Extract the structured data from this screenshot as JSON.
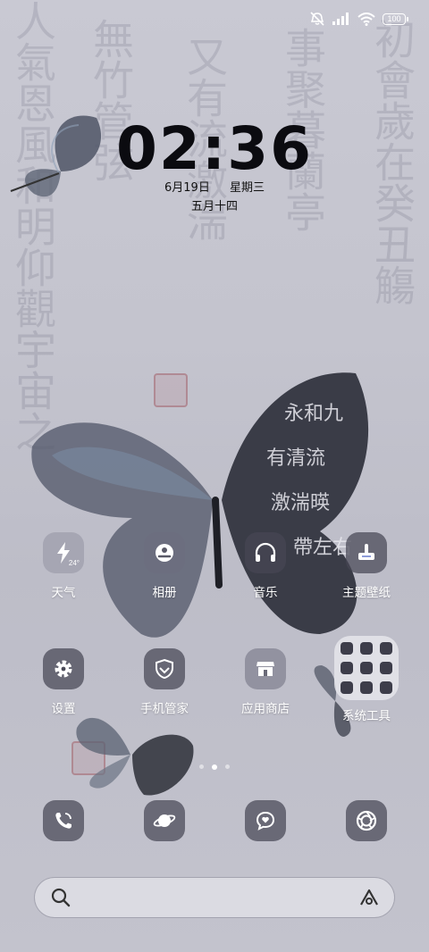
{
  "status_bar": {
    "battery": "100",
    "icons": [
      "notifications-muted-icon",
      "signal-icon",
      "wifi-icon",
      "battery-icon"
    ]
  },
  "clock": {
    "time": "02:36",
    "date": "6月19日",
    "weekday": "星期三",
    "lunar": "五月十四"
  },
  "apps": [
    {
      "label": "天气",
      "icon": "weather-bolt-icon",
      "badge": "24°"
    },
    {
      "label": "相册",
      "icon": "gallery-icon"
    },
    {
      "label": "音乐",
      "icon": "headphones-icon"
    },
    {
      "label": "主题壁纸",
      "icon": "theme-brush-icon"
    },
    {
      "label": "设置",
      "icon": "gear-icon"
    },
    {
      "label": "手机管家",
      "icon": "security-shield-icon"
    },
    {
      "label": "应用商店",
      "icon": "store-icon"
    },
    {
      "label": "系统工具",
      "icon": "folder-icon"
    }
  ],
  "pages": {
    "count": 3,
    "active": 2
  },
  "dock": [
    {
      "icon": "phone-icon"
    },
    {
      "icon": "browser-planet-icon"
    },
    {
      "icon": "messages-icon"
    },
    {
      "icon": "camera-aperture-icon"
    }
  ],
  "search": {
    "placeholder": ""
  },
  "colors": {
    "tile": "#46465480",
    "background": "#c4c4ce",
    "clock": "#0b0b10"
  }
}
